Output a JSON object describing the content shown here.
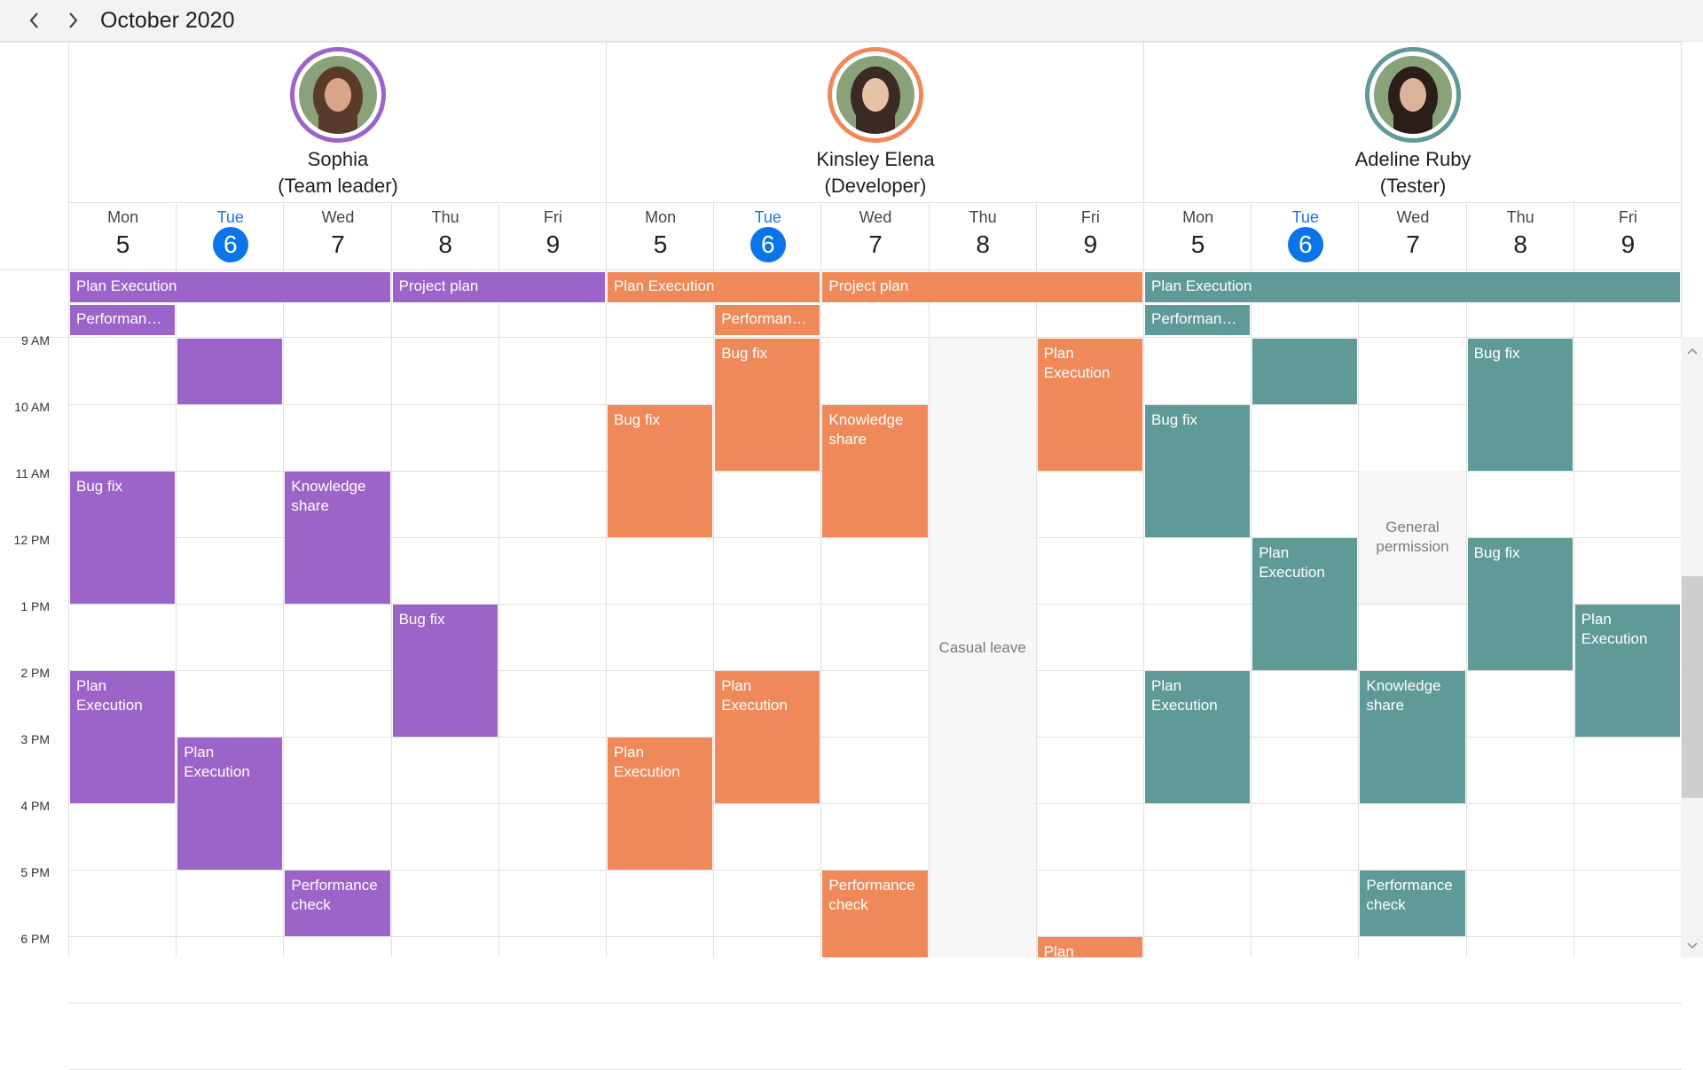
{
  "header": {
    "title": "October 2020"
  },
  "colors": {
    "sophia": "#9c63c9",
    "kinsley": "#f0895a",
    "adeline": "#5f9a98",
    "today": "#0b74e8"
  },
  "resources": [
    {
      "key": "sophia",
      "name": "Sophia",
      "role": "(Team leader)",
      "color": "#9c63c9"
    },
    {
      "key": "kinsley",
      "name": "Kinsley Elena",
      "role": "(Developer)",
      "color": "#f0895a"
    },
    {
      "key": "adeline",
      "name": "Adeline Ruby",
      "role": "(Tester)",
      "color": "#5f9a98"
    }
  ],
  "days": [
    {
      "dow": "Mon",
      "num": "5",
      "today": false
    },
    {
      "dow": "Tue",
      "num": "6",
      "today": true
    },
    {
      "dow": "Wed",
      "num": "7",
      "today": false
    },
    {
      "dow": "Thu",
      "num": "8",
      "today": false
    },
    {
      "dow": "Fri",
      "num": "9",
      "today": false
    }
  ],
  "time_labels": [
    "9 AM",
    "10 AM",
    "11 AM",
    "12 PM",
    "1 PM",
    "2 PM",
    "3 PM",
    "4 PM",
    "5 PM",
    "6 PM"
  ],
  "allday_events": [
    {
      "resource": 0,
      "startDay": 0,
      "endDay": 2,
      "row": 0,
      "title": "Plan Execution"
    },
    {
      "resource": 0,
      "startDay": 3,
      "endDay": 4,
      "row": 0,
      "title": "Project plan"
    },
    {
      "resource": 0,
      "startDay": 0,
      "endDay": 0,
      "row": 1,
      "title": "Performance check"
    },
    {
      "resource": 1,
      "startDay": 0,
      "endDay": 1,
      "row": 0,
      "title": "Plan Execution"
    },
    {
      "resource": 1,
      "startDay": 2,
      "endDay": 4,
      "row": 0,
      "title": "Project plan"
    },
    {
      "resource": 1,
      "startDay": 1,
      "endDay": 1,
      "row": 1,
      "title": "Performance check"
    },
    {
      "resource": 2,
      "startDay": 0,
      "endDay": 4,
      "row": 0,
      "title": "Plan Execution"
    },
    {
      "resource": 2,
      "startDay": 0,
      "endDay": 0,
      "row": 1,
      "title": "Performance check"
    }
  ],
  "events": [
    {
      "resource": 0,
      "day": 1,
      "start": 9,
      "end": 10,
      "title": ""
    },
    {
      "resource": 0,
      "day": 0,
      "start": 11,
      "end": 13,
      "title": "Bug fix"
    },
    {
      "resource": 0,
      "day": 2,
      "start": 11,
      "end": 13,
      "title": "Knowledge share"
    },
    {
      "resource": 0,
      "day": 3,
      "start": 13,
      "end": 15,
      "title": "Bug fix"
    },
    {
      "resource": 0,
      "day": 0,
      "start": 14,
      "end": 16,
      "title": "Plan Execution"
    },
    {
      "resource": 0,
      "day": 1,
      "start": 15,
      "end": 17,
      "title": "Plan Execution"
    },
    {
      "resource": 0,
      "day": 2,
      "start": 17,
      "end": 18,
      "title": "Performance check"
    },
    {
      "resource": 1,
      "day": 1,
      "start": 9,
      "end": 11,
      "title": "Bug fix"
    },
    {
      "resource": 1,
      "day": 4,
      "start": 9,
      "end": 11,
      "title": "Plan Execution"
    },
    {
      "resource": 1,
      "day": 0,
      "start": 10,
      "end": 12,
      "title": "Bug fix"
    },
    {
      "resource": 1,
      "day": 2,
      "start": 10,
      "end": 12,
      "title": "Knowledge share"
    },
    {
      "resource": 1,
      "day": 1,
      "start": 14,
      "end": 16,
      "title": "Plan Execution"
    },
    {
      "resource": 1,
      "day": 0,
      "start": 15,
      "end": 17,
      "title": "Plan Execution"
    },
    {
      "resource": 1,
      "day": 2,
      "start": 17,
      "end": 18.5,
      "title": "Performance check"
    },
    {
      "resource": 1,
      "day": 4,
      "start": 18,
      "end": 19,
      "title": "Plan"
    },
    {
      "resource": 2,
      "day": 1,
      "start": 9,
      "end": 10,
      "title": ""
    },
    {
      "resource": 2,
      "day": 3,
      "start": 9,
      "end": 11,
      "title": "Bug fix"
    },
    {
      "resource": 2,
      "day": 0,
      "start": 10,
      "end": 12,
      "title": "Bug fix"
    },
    {
      "resource": 2,
      "day": 1,
      "start": 12,
      "end": 14,
      "title": "Plan Execution"
    },
    {
      "resource": 2,
      "day": 3,
      "start": 12,
      "end": 14,
      "title": "Bug fix"
    },
    {
      "resource": 2,
      "day": 4,
      "start": 13,
      "end": 15,
      "title": "Plan Execution"
    },
    {
      "resource": 2,
      "day": 0,
      "start": 14,
      "end": 16,
      "title": "Plan Execution"
    },
    {
      "resource": 2,
      "day": 2,
      "start": 14,
      "end": 16,
      "title": "Knowledge share"
    },
    {
      "resource": 2,
      "day": 2,
      "start": 17,
      "end": 18,
      "title": "Performance check"
    }
  ],
  "blocked": [
    {
      "resource": 1,
      "day": 3,
      "start": 9,
      "end": 19,
      "label": "Casual leave"
    },
    {
      "resource": 2,
      "day": 2,
      "start": 11,
      "end": 13,
      "label": "General permission"
    }
  ]
}
